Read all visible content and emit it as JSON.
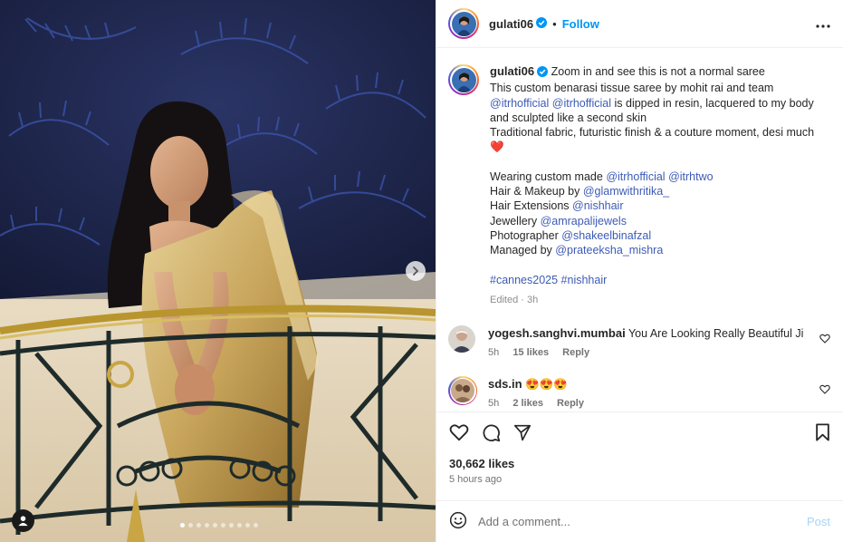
{
  "post": {
    "username": "gulati06",
    "follow_label": "Follow",
    "separator": "•",
    "caption": {
      "line1": "Zoom in and see this is not a normal saree",
      "line2": "This custom benarasi tissue saree by mohit rai and team",
      "mention1": "@itrhofficial",
      "mention2": "@itrhofficial",
      "line3a": "is dipped in resin, lacquered to my body",
      "line3b": "and sculpted like a second skin",
      "line4": "Traditional fabric, futuristic finish & a couture moment, desi much",
      "heart": "❤️",
      "credits": [
        {
          "label": "Wearing custom made",
          "mentions": [
            "@itrhofficial",
            "@itrhtwo"
          ]
        },
        {
          "label": "Hair & Makeup by",
          "mentions": [
            "@glamwithritika_"
          ]
        },
        {
          "label": "Hair Extensions",
          "mentions": [
            "@nishhair"
          ]
        },
        {
          "label": "Jewellery",
          "mentions": [
            "@amrapalijewels"
          ]
        },
        {
          "label": "Photographer",
          "mentions": [
            "@shakeelbinafzal"
          ]
        },
        {
          "label": "Managed by",
          "mentions": [
            "@prateeksha_mishra"
          ]
        }
      ],
      "hashtags": "#cannes2025 #nishhair",
      "meta": "Edited · 3h"
    },
    "comments": [
      {
        "username": "yogesh.sanghvi.mumbai",
        "text": "You Are Looking Really Beautiful Ji",
        "time": "5h",
        "likes": "15 likes",
        "reply": "Reply"
      },
      {
        "username": "sds.in",
        "text": "😍😍😍",
        "time": "5h",
        "likes": "2 likes",
        "reply": "Reply"
      }
    ],
    "likes": "30,662 likes",
    "posted": "5 hours ago",
    "comment_placeholder": "Add a comment...",
    "post_label": "Post",
    "carousel": {
      "total": 10,
      "active": 1
    }
  },
  "colors": {
    "link": "#0095f6",
    "mention": "#3d5bb5",
    "verified": "#0095f6"
  }
}
